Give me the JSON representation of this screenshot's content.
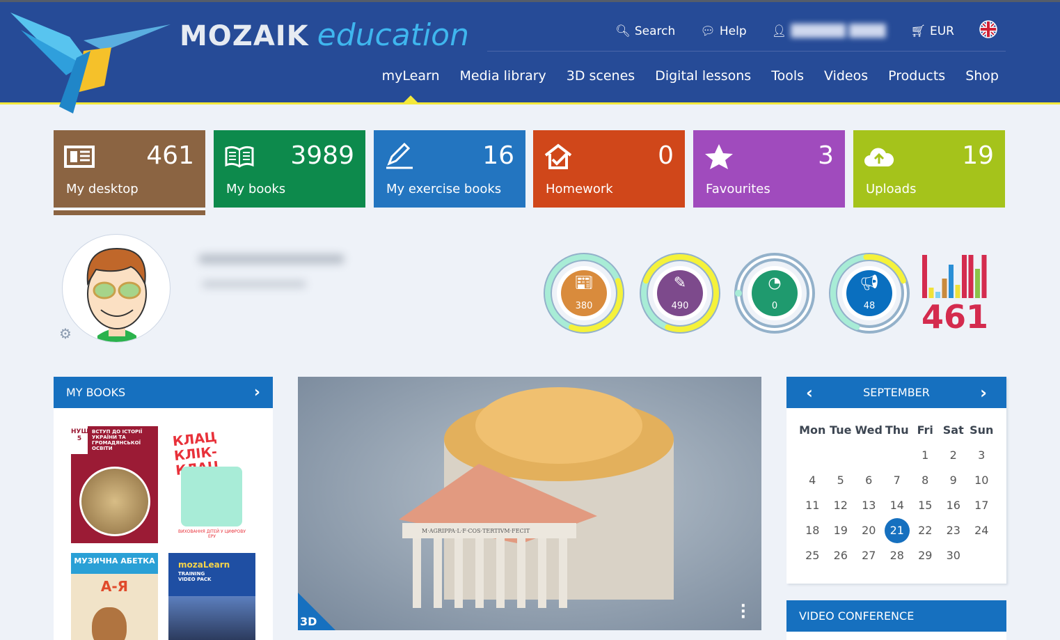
{
  "header": {
    "logo_brand": "MOZAIK",
    "logo_suffix": "education",
    "top_nav": [
      {
        "label": "Search",
        "icon": "search-icon"
      },
      {
        "label": "Help",
        "icon": "help-icon"
      },
      {
        "label": "",
        "icon": "user-icon"
      },
      {
        "label": "EUR",
        "icon": "cart-icon"
      }
    ],
    "language_flag": "uk-flag-icon",
    "main_nav": [
      "myLearn",
      "Media library",
      "3D scenes",
      "Digital lessons",
      "Tools",
      "Videos",
      "Products",
      "Shop"
    ],
    "active_nav": "myLearn"
  },
  "tiles": [
    {
      "label": "My desktop",
      "count": "461",
      "color": "#8b6442",
      "icon": "desktop-icon"
    },
    {
      "label": "My books",
      "count": "3989",
      "color": "#0d8a4c",
      "icon": "book-icon"
    },
    {
      "label": "My exercise books",
      "count": "16",
      "color": "#2375c0",
      "icon": "pencil-icon"
    },
    {
      "label": "Homework",
      "count": "0",
      "color": "#d0471a",
      "icon": "homework-icon"
    },
    {
      "label": "Favourites",
      "count": "3",
      "color": "#a04bbd",
      "icon": "star-icon"
    },
    {
      "label": "Uploads",
      "count": "19",
      "color": "#a5c31b",
      "icon": "cloud-upload-icon"
    }
  ],
  "stats": [
    {
      "value": "380",
      "color": "#d98b3c",
      "icon": "document-icon"
    },
    {
      "value": "490",
      "color": "#7d4a8c",
      "icon": "brushes-icon"
    },
    {
      "value": "0",
      "color": "#1f9a6e",
      "icon": "speedometer-icon"
    },
    {
      "value": "48",
      "color": "#0a6fbf",
      "icon": "megaphone-icon"
    }
  ],
  "total": {
    "value": "461",
    "color": "#d42b4e"
  },
  "my_books": {
    "title": "MY BOOKS",
    "books": [
      {
        "title": "ВСТУП ДО ІСТОРІЇ УКРАЇНИ ТА ГРОМАДЯНСЬКОЇ ОСВІТИ",
        "badge": "НУШ 5"
      },
      {
        "title": "КЛАЦ КЛІК-КЛАЦ",
        "subtitle": "ВИХОВАННЯ ДІТЕЙ У ЦИФРОВУ ЕРУ"
      },
      {
        "title": "МУЗИЧНА АБЕТКА",
        "subtitle": "А-Я"
      },
      {
        "title": "mozaLearn",
        "subtitle": "TRAINING VIDEO PACK"
      }
    ]
  },
  "feature": {
    "badge": "3D",
    "inscription": "M·AGRIPPA·L·F·COS·TERTIVM·FECIT"
  },
  "calendar": {
    "month": "SEPTEMBER",
    "weekdays": [
      "Mon",
      "Tue",
      "Wed",
      "Thu",
      "Fri",
      "Sat",
      "Sun"
    ],
    "days": [
      "",
      "",
      "",
      "",
      "1",
      "2",
      "3",
      "4",
      "5",
      "6",
      "7",
      "8",
      "9",
      "10",
      "11",
      "12",
      "13",
      "14",
      "15",
      "16",
      "17",
      "18",
      "19",
      "20",
      "21",
      "22",
      "23",
      "24",
      "25",
      "26",
      "27",
      "28",
      "29",
      "30",
      ""
    ],
    "today": "21"
  },
  "video_conference": {
    "title": "VIDEO CONFERENCE"
  }
}
